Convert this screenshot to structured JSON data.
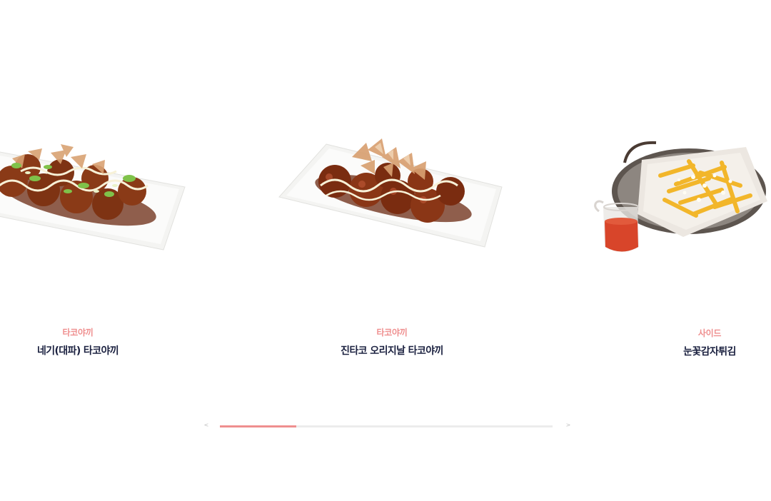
{
  "carousel": {
    "items": [
      {
        "category": "타코야끼",
        "title": "네기(대파) 타코야끼",
        "image": "negi-takoyaki-plate"
      },
      {
        "category": "타코야끼",
        "title": "진타코 오리지날 타코야끼",
        "image": "original-takoyaki-plate"
      },
      {
        "category": "사이드",
        "title": "눈꽃감자튀김",
        "image": "snow-fries-pan"
      }
    ],
    "pager": {
      "prev_label": "<",
      "next_label": ">",
      "progress": 0.23
    }
  },
  "colors": {
    "accent": "#ef8f8f",
    "title": "#1b2140",
    "track": "#ececec"
  }
}
